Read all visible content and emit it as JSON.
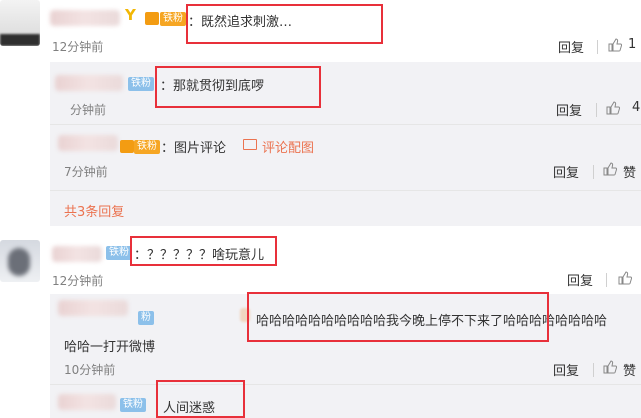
{
  "comments": [
    {
      "text": "：既然追求刺激…",
      "time": "12分钟前",
      "like": "1"
    },
    {
      "text": "：？？？？？啥玩意儿",
      "time": "12分钟前"
    }
  ],
  "replies": [
    {
      "badge": "铁粉",
      "text": "：那就贯彻到底啰",
      "time": "分钟前",
      "like": "4"
    },
    {
      "badge": "铁粉",
      "text": "：图片评论",
      "link": "评论配图",
      "time": "7分钟前",
      "like": "赞"
    },
    {
      "badge": "粉",
      "text_line1": "哈哈哈哈哈哈哈哈哈哈我今晚上停不下来了哈哈哈哈哈哈哈哈",
      "text_line2": "哈哈一打开微博",
      "time": "10分钟前",
      "like": "赞"
    },
    {
      "badge": "铁粉",
      "text": "人间迷惑"
    }
  ],
  "badges": {
    "first": "铁粉",
    "second": "铁粉"
  },
  "labels": {
    "reply": "回复",
    "more_replies": "共3条回复",
    "vip": "Y"
  },
  "colors": {
    "accent": "#eb7350",
    "annotation": "#e8303a",
    "badge": "#8cc0ea"
  }
}
